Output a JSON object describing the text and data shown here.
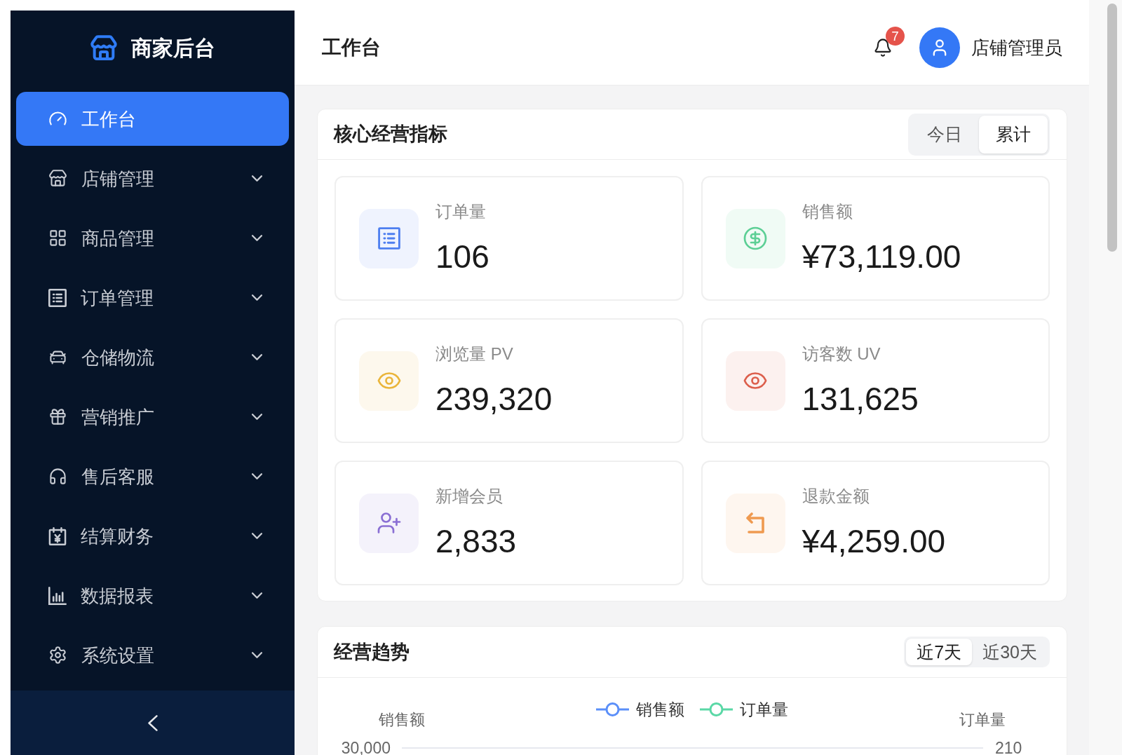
{
  "sidebar": {
    "logo_text": "商家后台",
    "items": [
      {
        "label": "工作台",
        "selected": true
      },
      {
        "label": "店铺管理",
        "selected": false,
        "expanded": false
      },
      {
        "label": "商品管理",
        "selected": false,
        "expanded": false
      },
      {
        "label": "订单管理",
        "selected": false,
        "expanded": false
      },
      {
        "label": "仓储物流",
        "selected": false,
        "expanded": false
      },
      {
        "label": "营销推广",
        "selected": false,
        "expanded": false
      },
      {
        "label": "售后客服",
        "selected": false,
        "expanded": false
      },
      {
        "label": "结算财务",
        "selected": false,
        "expanded": false
      },
      {
        "label": "数据报表",
        "selected": false,
        "expanded": false
      },
      {
        "label": "系统设置",
        "selected": false,
        "expanded": false
      }
    ]
  },
  "header": {
    "title": "工作台",
    "notification_count": "7",
    "user_name": "店铺管理员"
  },
  "metrics_panel": {
    "title": "核心经营指标",
    "tabs": [
      {
        "label": "今日",
        "selected": false
      },
      {
        "label": "累计",
        "selected": true
      }
    ],
    "stats": [
      {
        "label": "订单量",
        "value": "106",
        "color": "#4e7ff0"
      },
      {
        "label": "销售额",
        "value": "¥73,119.00",
        "color": "#5ccf95"
      },
      {
        "label": "浏览量 PV",
        "value": "239,320",
        "color": "#eab53a"
      },
      {
        "label": "访客数 UV",
        "value": "131,625",
        "color": "#dc5f4c"
      },
      {
        "label": "新增会员",
        "value": "2,833",
        "color": "#8a6fd4"
      },
      {
        "label": "退款金额",
        "value": "¥4,259.00",
        "color": "#ef9a50"
      }
    ]
  },
  "trend_panel": {
    "title": "经营趋势",
    "tabs": [
      {
        "label": "近7天",
        "selected": true
      },
      {
        "label": "近30天",
        "selected": false
      }
    ],
    "chart": {
      "legend": [
        {
          "label": "销售额",
          "color": "#5b8ff9"
        },
        {
          "label": "订单量",
          "color": "#5ad8a6"
        }
      ],
      "left_axis_title": "销售额",
      "right_axis_title": "订单量",
      "left_ticks": [
        "30,000"
      ],
      "right_ticks": [
        "210"
      ]
    }
  }
}
